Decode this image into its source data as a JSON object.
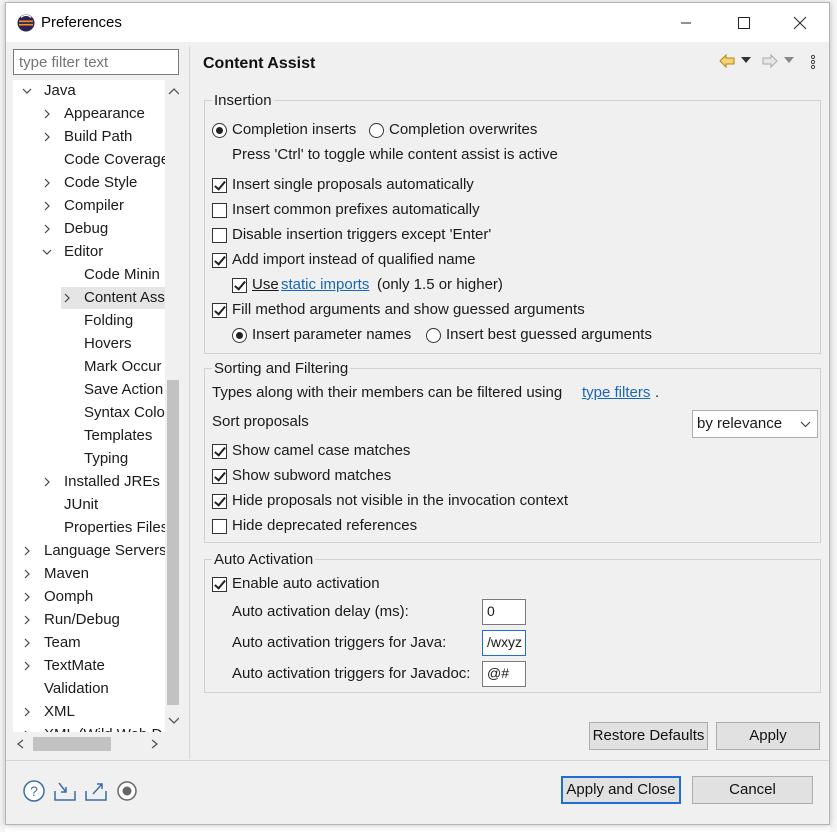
{
  "window": {
    "title": "Preferences"
  },
  "filter": {
    "placeholder": "type filter text"
  },
  "tree": {
    "java": "Java",
    "appearance": "Appearance",
    "build_path": "Build Path",
    "code_coverage": "Code Coverage",
    "code_style": "Code Style",
    "compiler": "Compiler",
    "debug": "Debug",
    "editor": "Editor",
    "code_mining": "Code Minin",
    "content_assist": "Content Ass",
    "folding": "Folding",
    "hovers": "Hovers",
    "mark_occurrences": "Mark Occur",
    "save_actions": "Save Action",
    "syntax_coloring": "Syntax Colo",
    "templates": "Templates",
    "typing": "Typing",
    "installed_jres": "Installed JREs",
    "junit": "JUnit",
    "properties_files": "Properties Files",
    "language_servers": "Language Servers",
    "maven": "Maven",
    "oomph": "Oomph",
    "run_debug": "Run/Debug",
    "team": "Team",
    "textmate": "TextMate",
    "validation": "Validation",
    "xml": "XML",
    "xml_wild": "XML (Wild Web D"
  },
  "page": {
    "title": "Content Assist"
  },
  "insertion": {
    "group": "Insertion",
    "completion_inserts": "Completion inserts",
    "completion_overwrites": "Completion overwrites",
    "toggle_hint": "Press 'Ctrl' to toggle while content assist is active",
    "insert_single": "Insert single proposals automatically",
    "insert_common": "Insert common prefixes automatically",
    "disable_triggers": "Disable insertion triggers except 'Enter'",
    "add_import": "Add import instead of qualified name",
    "use": "Use",
    "static_imports": "static imports",
    "only15": "(only 1.5 or higher)",
    "fill_args": "Fill method arguments and show guessed arguments",
    "insert_param_names": "Insert parameter names",
    "insert_best_guessed": "Insert best guessed arguments"
  },
  "sorting": {
    "group": "Sorting and Filtering",
    "types_text": "Types along with their members can be filtered using",
    "type_filters": "type filters",
    "period": ".",
    "sort_proposals": "Sort proposals",
    "sort_value": "by relevance",
    "camel_case": "Show camel case matches",
    "subword": "Show subword matches",
    "hide_not_visible": "Hide proposals not visible in the invocation context",
    "hide_deprecated": "Hide deprecated references"
  },
  "auto": {
    "group": "Auto Activation",
    "enable": "Enable auto activation",
    "delay_label": "Auto activation delay (ms):",
    "delay_value": "0",
    "java_label": "Auto activation triggers for Java:",
    "java_value": "/wxyz",
    "javadoc_label": "Auto activation triggers for Javadoc:",
    "javadoc_value": "@#"
  },
  "buttons": {
    "restore_defaults": "Restore Defaults",
    "apply": "Apply",
    "apply_close": "Apply and Close",
    "cancel": "Cancel"
  },
  "colors": {
    "accent": "#1f6fd0",
    "link": "#1a66b5",
    "dialog_bg": "#f0f0f0"
  }
}
